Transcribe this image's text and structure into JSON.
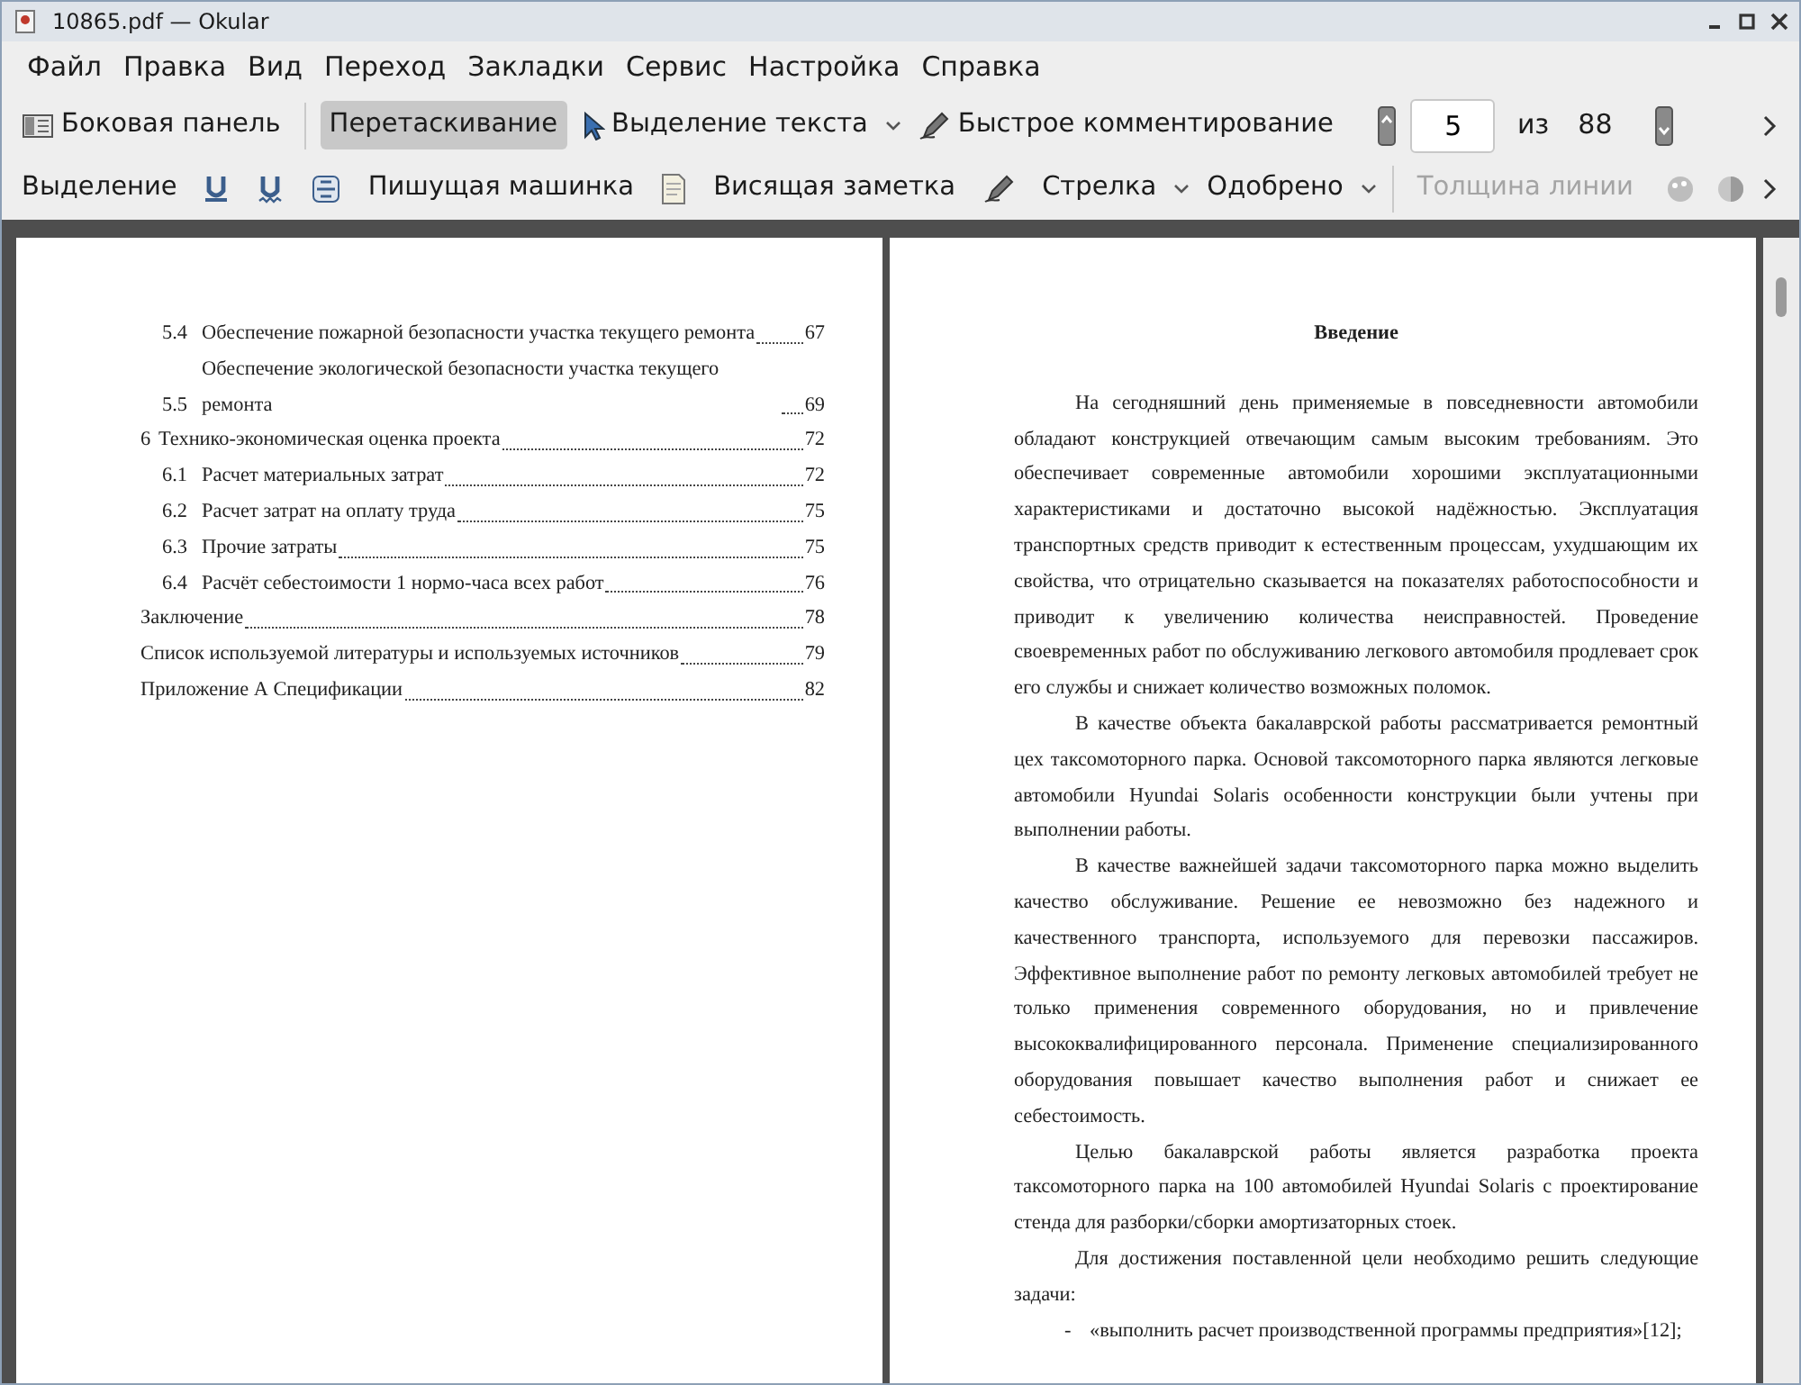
{
  "window": {
    "title": "10865.pdf — Okular"
  },
  "menu": [
    "Файл",
    "Правка",
    "Вид",
    "Переход",
    "Закладки",
    "Сервис",
    "Настройка",
    "Справка"
  ],
  "sidebar_button": {
    "label": "Боковая панель",
    "checked": false
  },
  "tools": [
    {
      "label": "Перетаскивание",
      "selected": true,
      "menu": false
    },
    {
      "label": "Выделение текста",
      "selected": false,
      "menu": true
    },
    {
      "label": "Быстрое комментирование",
      "selected": false,
      "menu": false
    }
  ],
  "page_nav": {
    "page": "5",
    "of": "из",
    "total": "88"
  },
  "annotation_tools": [
    {
      "label": "Выделение",
      "menu": false,
      "disabled": false
    },
    {
      "label": "Пишущая машинка",
      "menu": false,
      "disabled": false
    },
    {
      "label": "Висящая заметка",
      "menu": false,
      "disabled": false
    },
    {
      "label": "Стрелка",
      "menu": true,
      "disabled": false
    },
    {
      "label": "Одобрено",
      "menu": true,
      "disabled": false
    },
    {
      "label": "Толщина линии",
      "menu": false,
      "disabled": true
    }
  ],
  "left_page": {
    "toc": [
      {
        "children": [
          {
            "number": "5.4",
            "title": "Обеспечение пожарной безопасности участка текущего ремонта",
            "page": "67"
          },
          {
            "number": "5.5",
            "title": "Обеспечение экологической безопасности участка текущего ремонта",
            "page": "69"
          }
        ]
      },
      {
        "number": "6",
        "title": "Технико-экономическая оценка проекта",
        "page": "72",
        "children": [
          {
            "number": "6.1",
            "title": "Расчет материальных затрат",
            "page": "72"
          },
          {
            "number": "6.2",
            "title": "Расчет затрат на оплату труда",
            "page": "75"
          },
          {
            "number": "6.3",
            "title": "Прочие затраты",
            "page": "75"
          },
          {
            "number": "6.4",
            "title": "Расчёт себестоимости 1 нормо-часа всех работ",
            "page": "76"
          }
        ]
      },
      {
        "title": "Заключение",
        "page": "78"
      },
      {
        "title": "Список используемой литературы и используемых источников",
        "page": "79"
      },
      {
        "title": "Приложение А Спецификации",
        "page": "82"
      }
    ]
  },
  "right_page": {
    "heading": "Введение",
    "paragraphs": [
      "На сегодняшний день применяемые в повседневности автомобили обладают конструкцией отвечающим самым высоким требованиям. Это обеспечивает современные автомобили хорошими эксплуатационными характеристиками и достаточно высокой надёжностью. Эксплуатация транспортных средств приводит к естественным процессам, ухудшающим их свойства, что отрицательно сказывается на показателях работоспособности и приводит к увеличению количества неисправностей. Проведение своевременных работ по обслуживанию легкового автомобиля продлевает срок его службы и снижает количество возможных поломок.",
      "В качестве объекта бакалаврской работы рассматривается ремонтный цех таксомоторного парка. Основой таксомоторного парка являются легковые автомобили Hyundai Solaris особенности конструкции были учтены при выполнении работы.",
      "В качестве важнейшей задачи таксомоторного парка можно выделить качество обслуживание. Решение ее невозможно без надежного и качественного транспорта, используемого для перевозки пассажиров. Эффективное выполнение работ по ремонту легковых автомобилей требует не только применения современного оборудования, но и привлечение высококвалифицированного персонала. Применение специализированного оборудования повышает качество выполнения работ и снижает ее себестоимость.",
      "Целью бакалаврской работы является разработка проекта таксомоторного парка на 100 автомобилей Hyundai Solaris с проектирование стенда для разборки/сборки амортизаторных стоек.",
      "Для достижения поставленной цели необходимо решить следующие задачи:"
    ],
    "list_items": [
      {
        "marker": "-",
        "text": "«выполнить расчет производственной программы предприятия»[12];"
      }
    ]
  }
}
